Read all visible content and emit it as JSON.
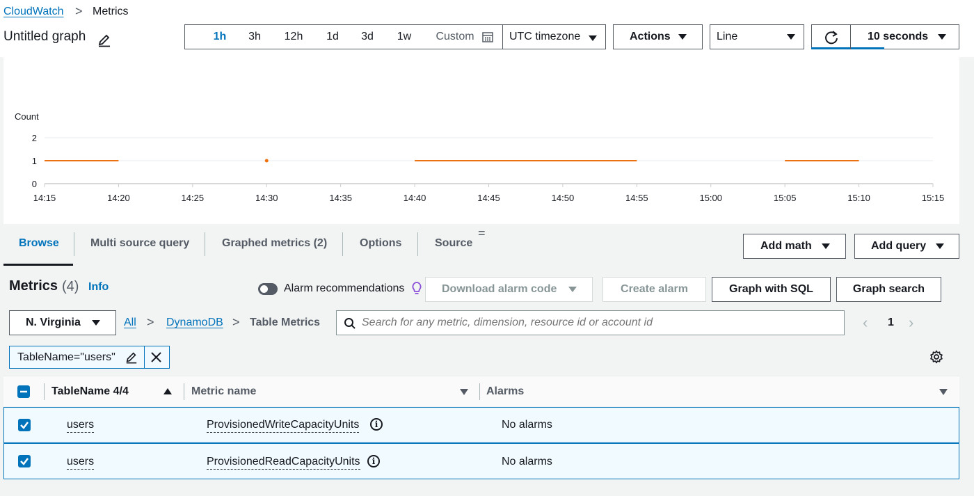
{
  "breadcrumb": {
    "root": "CloudWatch",
    "separator": ">",
    "current": "Metrics"
  },
  "graph": {
    "title": "Untitled graph"
  },
  "time_range": {
    "options": [
      "1h",
      "3h",
      "12h",
      "1d",
      "3d",
      "1w"
    ],
    "active": "1h",
    "custom_label": "Custom",
    "timezone": "UTC timezone"
  },
  "toolbar": {
    "actions_label": "Actions",
    "graph_type": "Line",
    "refresh_interval": "10 seconds"
  },
  "chart_data": {
    "type": "line",
    "ylabel": "Count",
    "ylim": [
      0,
      2
    ],
    "yticks": [
      "0",
      "1",
      "2"
    ],
    "xticks": [
      "14:15",
      "14:20",
      "14:25",
      "14:30",
      "14:35",
      "14:40",
      "14:45",
      "14:50",
      "14:55",
      "15:00",
      "15:05",
      "15:10",
      "15:15"
    ],
    "color": "#ec7211",
    "segments": [
      {
        "x_start": "14:15",
        "x_end": "14:20",
        "y": 1
      },
      {
        "x_start": "14:30",
        "x_end": "14:30",
        "y": 1
      },
      {
        "x_start": "14:40",
        "x_end": "14:55",
        "y": 1
      },
      {
        "x_start": "15:05",
        "x_end": "15:10",
        "y": 1
      }
    ]
  },
  "tabs": [
    {
      "label": "Browse",
      "active": true
    },
    {
      "label": "Multi source query",
      "active": false
    },
    {
      "label": "Graphed metrics (2)",
      "active": false
    },
    {
      "label": "Options",
      "active": false
    },
    {
      "label": "Source",
      "active": false
    }
  ],
  "tab_actions": {
    "add_math": "Add math",
    "add_query": "Add query"
  },
  "metrics_header": {
    "title": "Metrics",
    "count": "(4)",
    "info": "Info",
    "alarm_recommendations": "Alarm recommendations",
    "download_alarm_code": "Download alarm code",
    "create_alarm": "Create alarm",
    "graph_with_sql": "Graph with SQL",
    "graph_search": "Graph search"
  },
  "filters": {
    "region": "N. Virginia",
    "path": [
      "All",
      "DynamoDB",
      "Table Metrics"
    ],
    "search_placeholder": "Search for any metric, dimension, resource id or account id",
    "page": "1",
    "token": "TableName=\"users\""
  },
  "table": {
    "columns": [
      "TableName 4/4",
      "Metric name",
      "Alarms"
    ],
    "rows": [
      {
        "table_name": "users",
        "metric": "ProvisionedWriteCapacityUnits",
        "alarms": "No alarms"
      },
      {
        "table_name": "users",
        "metric": "ProvisionedReadCapacityUnits",
        "alarms": "No alarms"
      }
    ]
  }
}
